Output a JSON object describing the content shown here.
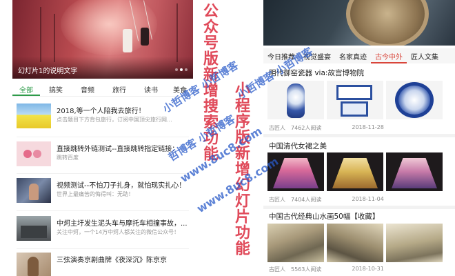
{
  "left_phone": {
    "banner_caption": "幻灯片1的说明文字",
    "tabs": [
      "全部",
      "搞笑",
      "音频",
      "旅行",
      "读书",
      "美食"
    ],
    "active_tab": "全部",
    "articles": [
      {
        "title": "2018,等一个人陪我去旅行！",
        "sub": "点击题目下方背包旅行，订阅中国顶尖旅行网..."
      },
      {
        "title": "直接跳转外链测试--直接跳转指定链接：",
        "sub": "跳转百度"
      },
      {
        "title": "视频测试--不怕刀子扎身，就怕现实扎心！",
        "sub": "世界上最痛苦的悔得叫：无助！"
      },
      {
        "title": "中炣主圩发生泥头车与摩托车相撞事故，...",
        "sub": "关注中炣，一个14万中炣人都关注的微信公众号！"
      },
      {
        "title": "三弦演奏京剧曲牌《夜深沉》陈京京",
        "sub": ""
      }
    ]
  },
  "overlay": {
    "left_vertical": "公众号版新增搜索功能",
    "right_vertical": "小程序版新增幻灯片功能",
    "watermarks": [
      "小哲博客 小哲博客",
      "哲博客 小哲博客",
      "www.8uc8.com",
      "www.8uc8.com",
      "小哲博客 小哲博客"
    ]
  },
  "right_phone": {
    "tabs": [
      "今日推荐",
      "视觉盛宴",
      "名家真迹",
      "古今中外",
      "匠人文集"
    ],
    "active_tab": "古今中外",
    "sections": [
      {
        "title": "明代御窑瓷器 via:故宫博物院",
        "author": "古匠人",
        "reads": "7462人阅读",
        "date": "2018-11-28"
      },
      {
        "title": "中国清代女裙之美",
        "author": "古匠人",
        "reads": "7404人阅读",
        "date": "2018-11-04"
      },
      {
        "title": "中国古代经典山水画50幅【收藏】",
        "author": "古匠人",
        "reads": "5563人阅读",
        "date": "2018-10-31"
      }
    ]
  },
  "colors": {
    "left_tab_active": "#2e9b4a",
    "right_tab_active": "#d9453a",
    "overlay_text": "#e04a5a",
    "watermark": "#285ac8"
  }
}
